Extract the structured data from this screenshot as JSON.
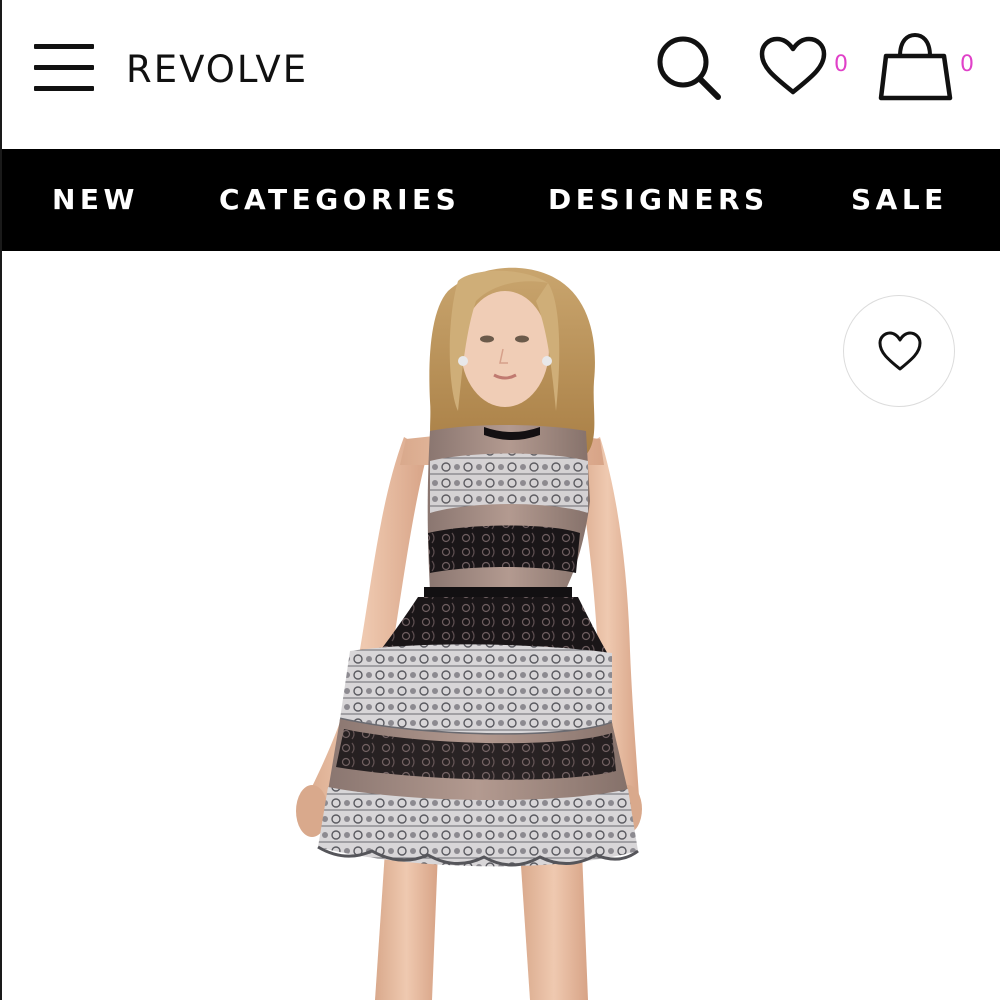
{
  "header": {
    "logo": "REVOLVE",
    "wishlist_count": "0",
    "bag_count": "0",
    "icons": {
      "menu": "hamburger-menu-icon",
      "search": "magnifier-search-icon",
      "wishlist": "heart-outline-icon",
      "bag": "shopping-bag-icon"
    }
  },
  "nav": {
    "items": [
      {
        "label": "NEW"
      },
      {
        "label": "CATEGORIES"
      },
      {
        "label": "DESIGNERS"
      },
      {
        "label": "SALE"
      }
    ]
  },
  "product": {
    "image": "model-wearing-tiered-lace-mini-dress",
    "favorite_icon": "heart-outline-icon"
  },
  "colors": {
    "nav_background": "#000000",
    "nav_text": "#ffffff",
    "count_badge": "#e040c8",
    "icon_stroke": "#111111"
  }
}
